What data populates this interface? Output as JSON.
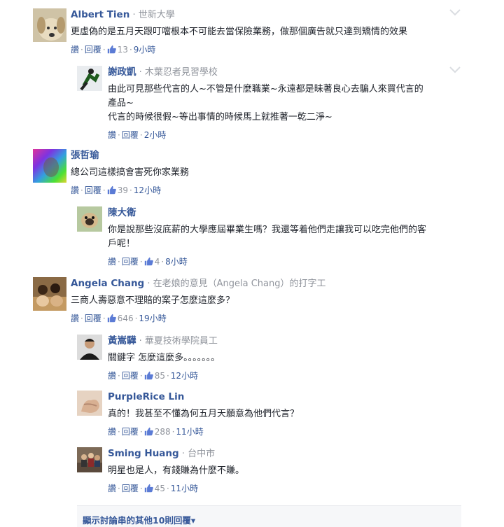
{
  "comments": [
    {
      "author": "Albert Tien",
      "affiliation": "世新大學",
      "lines": [
        "更虛偽的是五月天跟叮噹根本不可能去當保險業務，做那個廣告就只達到矯情的效果"
      ],
      "reply_label": "讚",
      "respond_label": "回覆",
      "likes": "13",
      "time": "9小時",
      "avatar": "dog-avatar-icon"
    },
    {
      "author": "謝政凱",
      "affiliation": "木葉忍者見習學校",
      "lines": [
        "由此可見那些代言的人~不管是什麼職業~永遠都是昧著良心去騙人來買代言的",
        "產品~",
        "代言的時候很假~等出事情的時候馬上就推著一乾二淨~"
      ],
      "reply_label": "讚",
      "respond_label": "回覆",
      "likes": "",
      "time": "2小時",
      "avatar": "runner-avatar-icon"
    },
    {
      "author": "張哲瑜",
      "affiliation": "",
      "lines": [
        "總公司這樣搞會害死你家業務"
      ],
      "reply_label": "讚",
      "respond_label": "回覆",
      "likes": "39",
      "time": "12小時",
      "avatar": "rainbow-avatar-icon"
    },
    {
      "author": "陳大衛",
      "affiliation": "",
      "lines": [
        "你是說那些沒底薪的大學應屆畢業生嗎？我還等着他們走讓我可以吃完他們的客",
        "戶呢！"
      ],
      "reply_label": "讚",
      "respond_label": "回覆",
      "likes": "4",
      "time": "8小時",
      "avatar": "pug-avatar-icon"
    },
    {
      "author": "Angela Chang",
      "affiliation": "在老娘的意見（Angela Chang）的打字工",
      "lines": [
        "三商人壽惡意不理賠的案子怎麼這麼多？"
      ],
      "reply_label": "讚",
      "respond_label": "回覆",
      "likes": "646",
      "time": "19小時",
      "avatar": "group-avatar-icon"
    },
    {
      "author": "黃嵩驊",
      "affiliation": "華夏技術學院員工",
      "lines": [
        "關鍵字 怎麼這麼多。。。。。。。"
      ],
      "reply_label": "讚",
      "respond_label": "回覆",
      "likes": "85",
      "time": "12小時",
      "avatar": "man-avatar-icon"
    },
    {
      "author": "PurpleRice Lin",
      "affiliation": "",
      "lines": [
        "真的！我甚至不懂為何五月天願意為他們代言？"
      ],
      "reply_label": "讚",
      "respond_label": "回覆",
      "likes": "288",
      "time": "11小時",
      "avatar": "hand-avatar-icon"
    },
    {
      "author": "Sming Huang",
      "affiliation": "台中市",
      "lines": [
        "明星也是人，有錢賺為什麼不賺。"
      ],
      "reply_label": "讚",
      "respond_label": "回覆",
      "likes": "45",
      "time": "11小時",
      "avatar": "people-avatar-icon"
    }
  ],
  "more_replies": "顯示討論串的其他10則回覆▾",
  "colors": {
    "link": "#365899",
    "meta": "#90949c",
    "text": "#1d2129"
  }
}
